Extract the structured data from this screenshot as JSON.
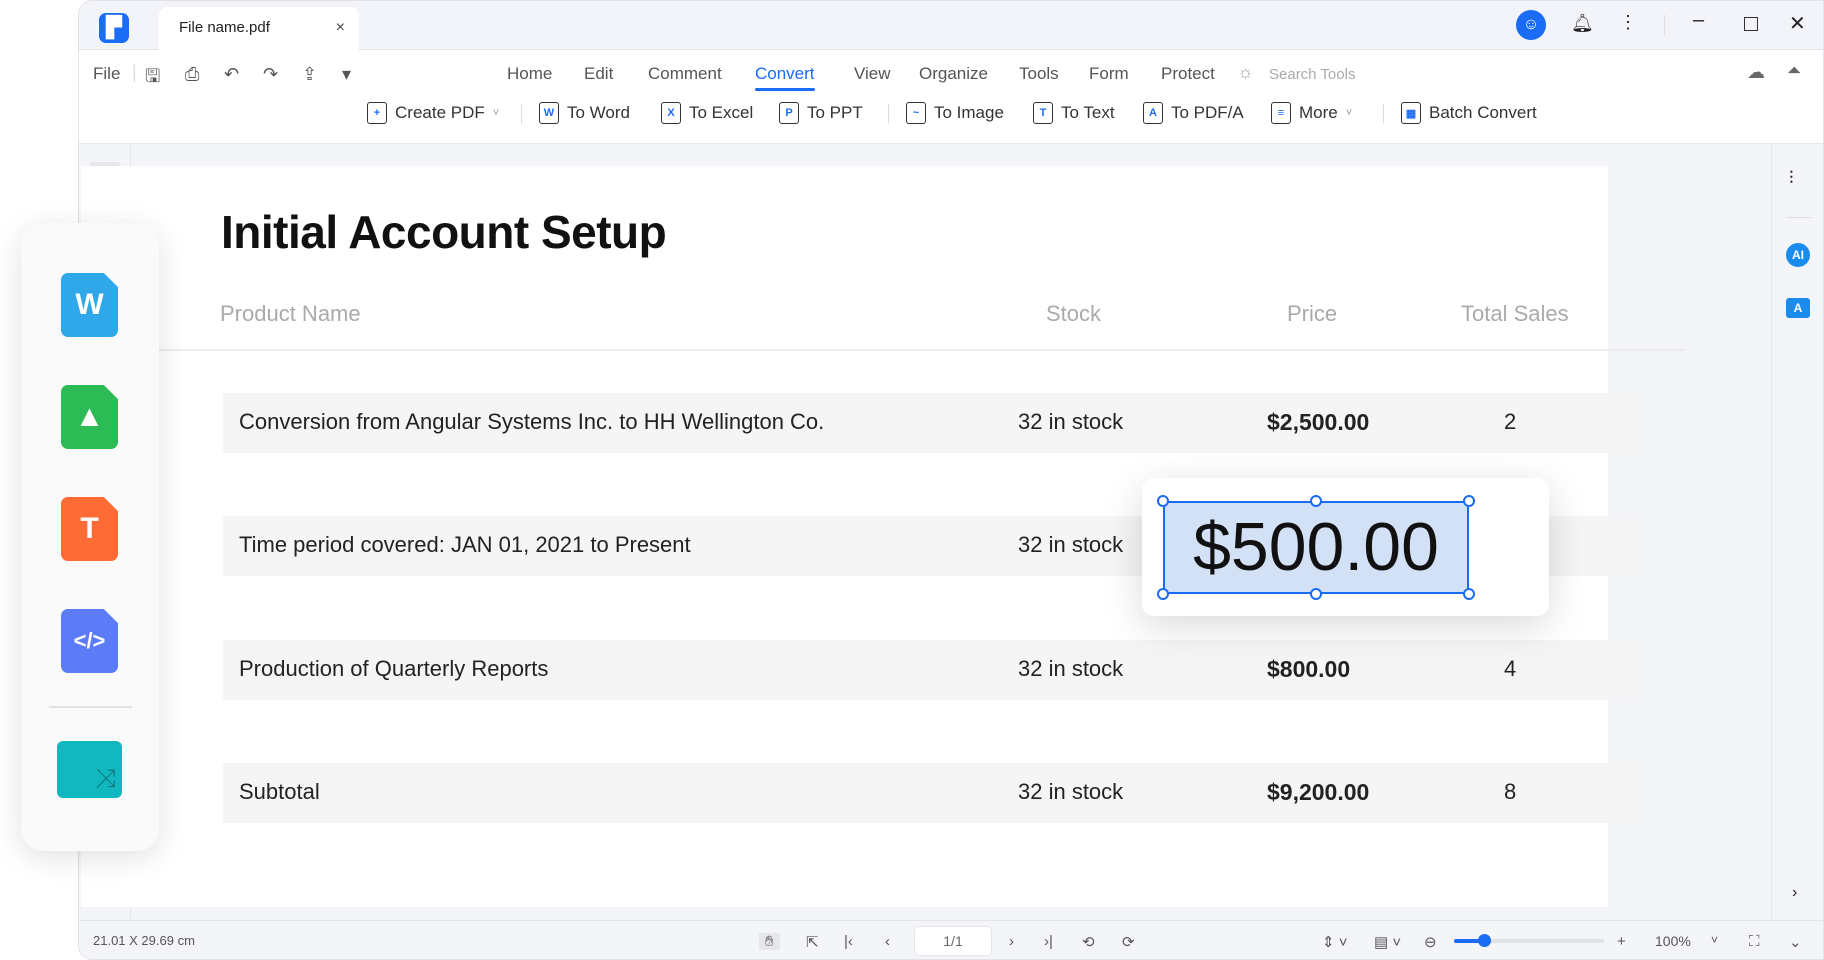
{
  "window": {
    "tab_title": "File name.pdf",
    "colors": {
      "accent": "#1a6cf5"
    }
  },
  "quick": {
    "file": "File"
  },
  "menu": [
    "Home",
    "Edit",
    "Comment",
    "Convert",
    "View",
    "Organize",
    "Tools",
    "Form",
    "Protect"
  ],
  "menu_active": "Convert",
  "search_placeholder": "Search Tools",
  "toolbar": [
    {
      "label": "Create PDF",
      "icon": "+"
    },
    {
      "label": "To Word",
      "icon": "W"
    },
    {
      "label": "To Excel",
      "icon": "X"
    },
    {
      "label": "To PPT",
      "icon": "P"
    },
    {
      "label": "To Image",
      "icon": "~"
    },
    {
      "label": "To Text",
      "icon": "T"
    },
    {
      "label": "To PDF/A",
      "icon": "A"
    },
    {
      "label": "More",
      "icon": "≡"
    },
    {
      "label": "Batch Convert",
      "icon": "▦"
    }
  ],
  "document": {
    "title": "Initial Account Setup",
    "headers": [
      "Product Name",
      "Stock",
      "Price",
      "Total Sales"
    ],
    "rows": [
      {
        "name": "Conversion from Angular Systems Inc. to HH Wellington Co.",
        "stock": "32 in stock",
        "price": "$2,500.00",
        "sales": "2"
      },
      {
        "name": "Time period covered: JAN 01, 2021 to Present",
        "stock": "32 in stock",
        "price": "",
        "sales": ""
      },
      {
        "name": "Production of Quarterly Reports",
        "stock": "32 in stock",
        "price": "$800.00",
        "sales": "4"
      },
      {
        "name": "Subtotal",
        "stock": "32 in stock",
        "price": "$9,200.00",
        "sales": "8"
      }
    ],
    "selected_value": "$500.00"
  },
  "float_panel": [
    {
      "name": "word",
      "glyph": "W",
      "color": "#2fa8ea"
    },
    {
      "name": "image",
      "glyph": "▲",
      "color": "#2dbb55"
    },
    {
      "name": "text",
      "glyph": "T",
      "color": "#ff6b35"
    },
    {
      "name": "html",
      "glyph": "</>",
      "color": "#5b7cf6"
    }
  ],
  "right_panel": {
    "ai": "AI"
  },
  "status": {
    "dimensions": "21.01 X 29.69 cm",
    "page": "1/1",
    "zoom": "100%",
    "zoom_fraction": 0.2
  }
}
